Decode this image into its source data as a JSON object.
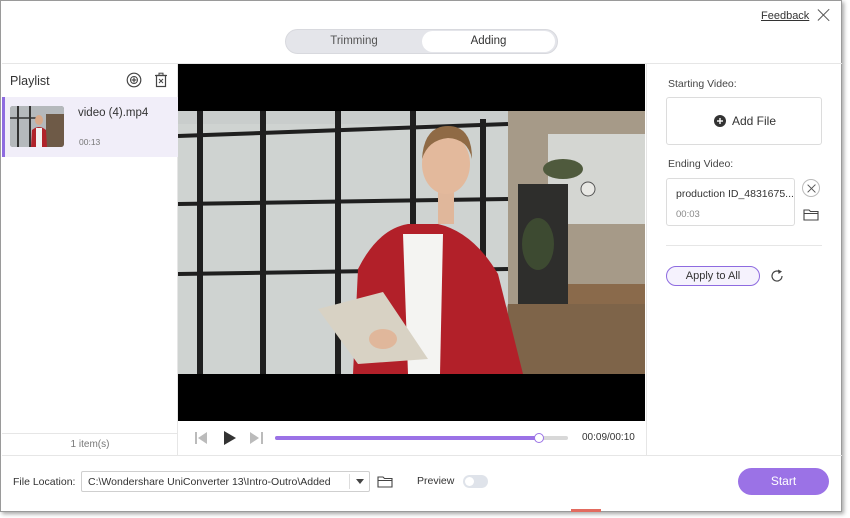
{
  "header": {
    "feedback_label": "Feedback",
    "tabs": [
      {
        "label": "Trimming",
        "active": false
      },
      {
        "label": "Adding",
        "active": true
      }
    ]
  },
  "playlist": {
    "title": "Playlist",
    "items": [
      {
        "name": "video (4).mp4",
        "duration": "00:13",
        "selected": true
      }
    ],
    "count_text": "1 item(s)"
  },
  "player": {
    "time_text": "00:09/00:10",
    "progress": 0.9
  },
  "adding_panel": {
    "starting_label": "Starting Video:",
    "add_file_label": "Add File",
    "ending_label": "Ending Video:",
    "ending_file_name": "production ID_4831675...",
    "ending_file_duration": "00:03",
    "apply_label": "Apply to All"
  },
  "footer": {
    "file_location_label": "File Location:",
    "file_location_value": "C:\\Wondershare UniConverter 13\\Intro-Outro\\Added",
    "preview_label": "Preview",
    "preview_enabled": false,
    "start_label": "Start"
  },
  "colors": {
    "accent": "#9b72e6",
    "selected_item_bg": "#f1eef9",
    "tab_track_bg": "#e4e5ea"
  }
}
